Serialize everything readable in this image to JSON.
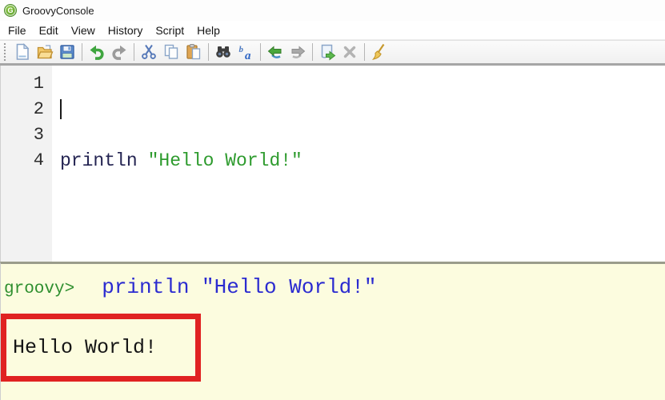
{
  "window": {
    "title": "GroovyConsole"
  },
  "menu_bar": {
    "items": [
      {
        "label": "File"
      },
      {
        "label": "Edit"
      },
      {
        "label": "View"
      },
      {
        "label": "History"
      },
      {
        "label": "Script"
      },
      {
        "label": "Help"
      }
    ]
  },
  "toolbar": {
    "buttons": [
      {
        "name": "new-file",
        "enabled": true
      },
      {
        "name": "open-file",
        "enabled": true
      },
      {
        "name": "save-file",
        "enabled": true
      },
      {
        "name": "undo",
        "enabled": true
      },
      {
        "name": "redo",
        "enabled": false
      },
      {
        "name": "cut",
        "enabled": true
      },
      {
        "name": "copy",
        "enabled": true
      },
      {
        "name": "paste",
        "enabled": true
      },
      {
        "name": "find",
        "enabled": true
      },
      {
        "name": "replace",
        "enabled": true
      },
      {
        "name": "history-previous",
        "enabled": true
      },
      {
        "name": "history-next",
        "enabled": false
      },
      {
        "name": "execute-script",
        "enabled": true
      },
      {
        "name": "interrupt-script",
        "enabled": false
      },
      {
        "name": "clear-output",
        "enabled": true
      }
    ]
  },
  "editor": {
    "line_numbers": [
      "1",
      "2",
      "3",
      "4"
    ],
    "caret_line": 2,
    "code_line": {
      "keyword": "println",
      "string": "\"Hello World!\""
    }
  },
  "output": {
    "prompt": "groovy>",
    "echo_code": "println \"Hello World!\"",
    "result": "Hello World!"
  },
  "colors": {
    "keyword_navy": "#242452",
    "string_green": "#2e9b2e",
    "prompt_green": "#2f8f2f",
    "echo_blue": "#2b2bd0",
    "output_bg": "#fcfcdf",
    "annotation_red": "#e02222",
    "toolbar_border": "#a5a5a5"
  }
}
